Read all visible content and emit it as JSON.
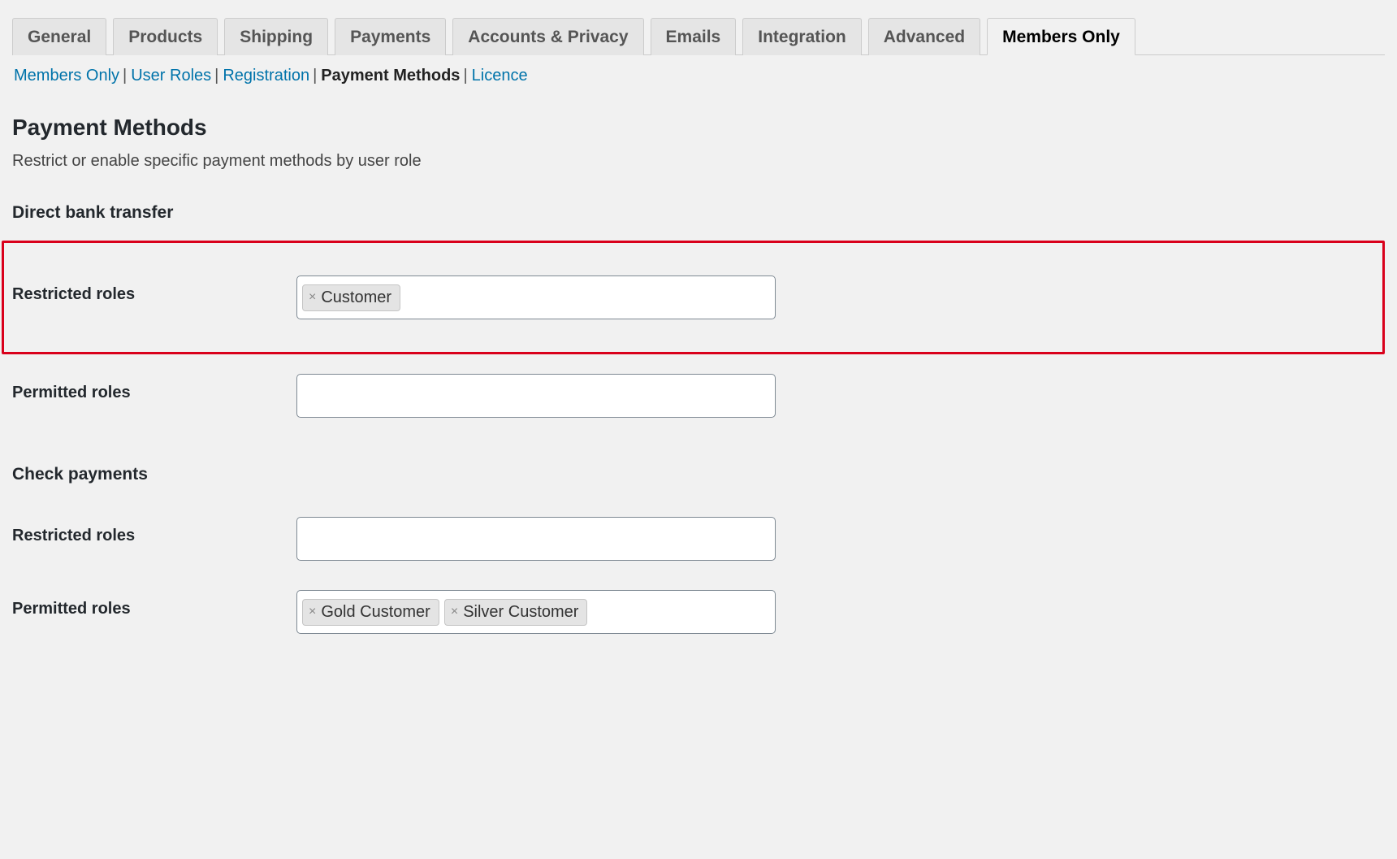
{
  "tabs": [
    {
      "label": "General",
      "active": false
    },
    {
      "label": "Products",
      "active": false
    },
    {
      "label": "Shipping",
      "active": false
    },
    {
      "label": "Payments",
      "active": false
    },
    {
      "label": "Accounts & Privacy",
      "active": false
    },
    {
      "label": "Emails",
      "active": false
    },
    {
      "label": "Integration",
      "active": false
    },
    {
      "label": "Advanced",
      "active": false
    },
    {
      "label": "Members Only",
      "active": true
    }
  ],
  "subnav": [
    {
      "label": "Members Only",
      "current": false
    },
    {
      "label": "User Roles",
      "current": false
    },
    {
      "label": "Registration",
      "current": false
    },
    {
      "label": "Payment Methods",
      "current": true
    },
    {
      "label": "Licence",
      "current": false
    }
  ],
  "page": {
    "title": "Payment Methods",
    "desc": "Restrict or enable specific payment methods by user role"
  },
  "labels": {
    "restricted": "Restricted roles",
    "permitted": "Permitted roles"
  },
  "sections": [
    {
      "heading": "Direct bank transfer",
      "restricted_tags": [
        "Customer"
      ],
      "restricted_highlight": true,
      "permitted_tags": []
    },
    {
      "heading": "Check payments",
      "restricted_tags": [],
      "restricted_highlight": false,
      "permitted_tags": [
        "Gold Customer",
        "Silver Customer"
      ]
    }
  ]
}
